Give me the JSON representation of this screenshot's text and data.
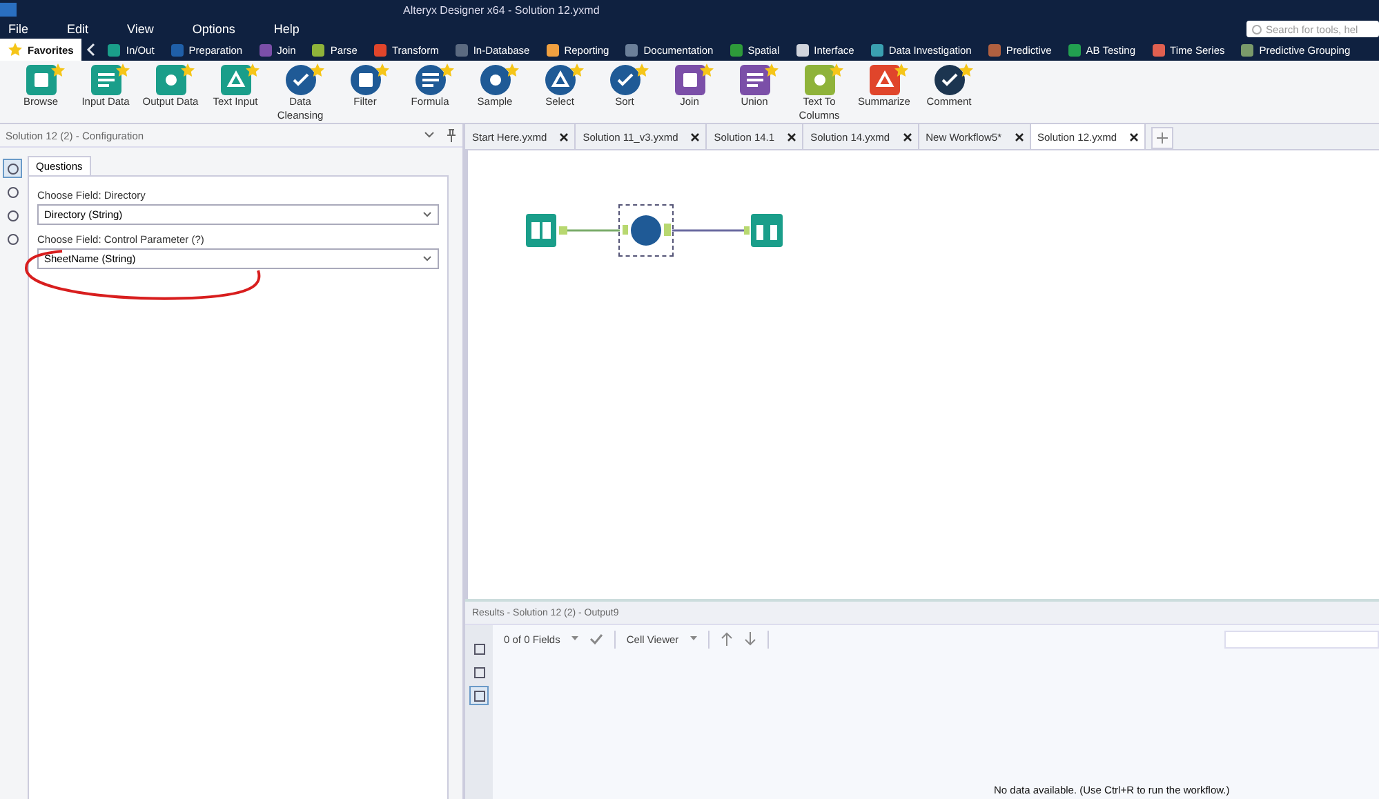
{
  "window": {
    "title": "Alteryx Designer x64 - Solution 12.yxmd"
  },
  "search": {
    "placeholder": "Search for tools, hel"
  },
  "menu": [
    "File",
    "Edit",
    "View",
    "Options",
    "Help"
  ],
  "categories": [
    {
      "label": "Favorites",
      "selected": true,
      "color": "#f5c518"
    },
    {
      "label": "In/Out",
      "selected": false,
      "color": "#1a9e8a"
    },
    {
      "label": "Preparation",
      "selected": false,
      "color": "#1f5fa8"
    },
    {
      "label": "Join",
      "selected": false,
      "color": "#7b4fa8"
    },
    {
      "label": "Parse",
      "selected": false,
      "color": "#8fb33a"
    },
    {
      "label": "Transform",
      "selected": false,
      "color": "#e0452b"
    },
    {
      "label": "In-Database",
      "selected": false,
      "color": "#5b6a80"
    },
    {
      "label": "Reporting",
      "selected": false,
      "color": "#f0a040"
    },
    {
      "label": "Documentation",
      "selected": false,
      "color": "#6b7f99"
    },
    {
      "label": "Spatial",
      "selected": false,
      "color": "#2e9a3a"
    },
    {
      "label": "Interface",
      "selected": false,
      "color": "#d0d4dc"
    },
    {
      "label": "Data Investigation",
      "selected": false,
      "color": "#3aa0b0"
    },
    {
      "label": "Predictive",
      "selected": false,
      "color": "#b06040"
    },
    {
      "label": "AB Testing",
      "selected": false,
      "color": "#22a050"
    },
    {
      "label": "Time Series",
      "selected": false,
      "color": "#e06050"
    },
    {
      "label": "Predictive Grouping",
      "selected": false,
      "color": "#7a9a6a"
    }
  ],
  "tools": [
    {
      "label": "Browse",
      "color": "#1a9e8a"
    },
    {
      "label": "Input Data",
      "color": "#1a9e8a"
    },
    {
      "label": "Output Data",
      "color": "#1a9e8a"
    },
    {
      "label": "Text Input",
      "color": "#1a9e8a"
    },
    {
      "label": "Data Cleansing",
      "color": "#1f5a96"
    },
    {
      "label": "Filter",
      "color": "#1f5a96"
    },
    {
      "label": "Formula",
      "color": "#1f5a96"
    },
    {
      "label": "Sample",
      "color": "#1f5a96"
    },
    {
      "label": "Select",
      "color": "#1f5a96"
    },
    {
      "label": "Sort",
      "color": "#1f5a96"
    },
    {
      "label": "Join",
      "color": "#7b4fa8"
    },
    {
      "label": "Union",
      "color": "#7b4fa8"
    },
    {
      "label": "Text To Columns",
      "color": "#8fb33a"
    },
    {
      "label": "Summarize",
      "color": "#e0452b"
    },
    {
      "label": "Comment",
      "color": "#1c3550"
    }
  ],
  "config": {
    "title": "Solution 12 (2) - Configuration",
    "side_icons": [
      {
        "selected": true
      },
      {
        "selected": false
      },
      {
        "selected": false
      },
      {
        "selected": false
      }
    ],
    "tab": "Questions",
    "fields": [
      {
        "label": "Choose Field: Directory",
        "value": "Directory (String)"
      },
      {
        "label": "Choose Field: Control Parameter (?)",
        "value": "SheetName (String)"
      }
    ]
  },
  "doc_tabs": [
    {
      "label": "Start Here.yxmd",
      "selected": false
    },
    {
      "label": "Solution 11_v3.yxmd",
      "selected": false
    },
    {
      "label": "Solution 14.1",
      "selected": false
    },
    {
      "label": "Solution 14.yxmd",
      "selected": false
    },
    {
      "label": "New Workflow5*",
      "selected": false
    },
    {
      "label": "Solution 12.yxmd",
      "selected": true
    }
  ],
  "workflow": {
    "nodes": [
      {
        "kind": "input",
        "selected": false
      },
      {
        "kind": "macro",
        "selected": true
      },
      {
        "kind": "browse",
        "selected": false
      }
    ]
  },
  "results": {
    "title": "Results - Solution 12 (2) - Output9",
    "side_icons": [
      {
        "selected": false
      },
      {
        "selected": false
      },
      {
        "selected": true
      }
    ],
    "fields": "0 of 0 Fields",
    "viewer": "Cell Viewer",
    "message": "No data available. (Use Ctrl+R to run the workflow.)"
  }
}
